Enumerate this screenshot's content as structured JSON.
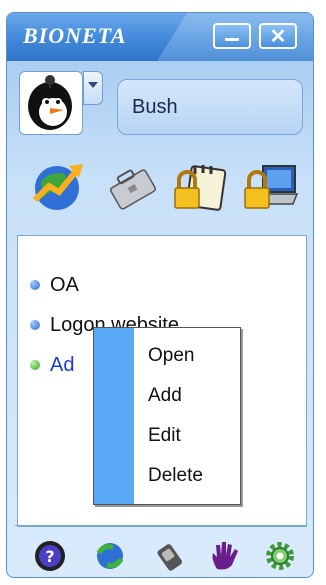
{
  "window": {
    "title": "BIONETA",
    "minimize_icon": "minimize-icon",
    "close_icon": "close-icon",
    "close_glyph": "✕"
  },
  "user": {
    "avatar_icon": "penguin-avatar-icon",
    "name": "Bush"
  },
  "toolbar": {
    "icons": [
      "globe-chart-icon",
      "briefcase-icon",
      "lock-clipboard-icon",
      "lock-laptop-icon"
    ]
  },
  "list": {
    "items": [
      {
        "label": "OA",
        "dot": "blue"
      },
      {
        "label": "Logon website",
        "dot": "blue"
      },
      {
        "label": "Ad",
        "dot": "green"
      }
    ]
  },
  "context_menu": {
    "items": [
      "Open",
      "Add",
      "Edit",
      "Delete"
    ]
  },
  "bottom_bar": {
    "icons": [
      "help-icon",
      "sync-icon",
      "fingerprint-reader-icon",
      "hand-icon",
      "settings-gear-icon"
    ]
  },
  "colors": {
    "title_bar": "#3f86d8",
    "menu_stripe": "#5aa9f7",
    "selected_text": "#1a3ccf"
  }
}
